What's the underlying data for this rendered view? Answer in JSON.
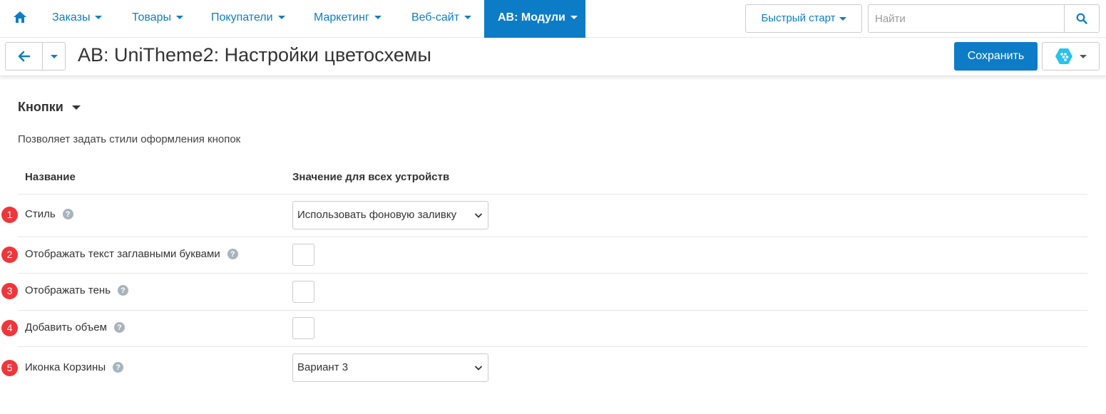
{
  "nav": {
    "home_icon": "home-icon",
    "items": [
      {
        "label": "Заказы"
      },
      {
        "label": "Товары"
      },
      {
        "label": "Покупатели"
      },
      {
        "label": "Маркетинг"
      },
      {
        "label": "Веб-сайт"
      },
      {
        "label": "AB: Модули",
        "active": true
      }
    ],
    "quick_start": "Быстрый старт",
    "search_placeholder": "Найти"
  },
  "header": {
    "title": "AB: UniTheme2: Настройки цветосхемы",
    "save_label": "Сохранить"
  },
  "section": {
    "title": "Кнопки",
    "description": "Позволяет задать стили оформления кнопок",
    "col_name": "Название",
    "col_value": "Значение для всех устройств",
    "rows": [
      {
        "badge": "1",
        "label": "Стиль",
        "type": "select",
        "value": "Использовать фоновую заливку"
      },
      {
        "badge": "2",
        "label": "Отображать текст заглавными буквами",
        "type": "checkbox",
        "checked": false
      },
      {
        "badge": "3",
        "label": "Отображать тень",
        "type": "checkbox",
        "checked": false
      },
      {
        "badge": "4",
        "label": "Добавить объем",
        "type": "checkbox",
        "checked": false
      },
      {
        "badge": "5",
        "label": "Иконка Корзины",
        "type": "select",
        "value": "Вариант 3"
      }
    ]
  },
  "colors": {
    "accent": "#0d7cc7",
    "badge": "#f0363a"
  }
}
